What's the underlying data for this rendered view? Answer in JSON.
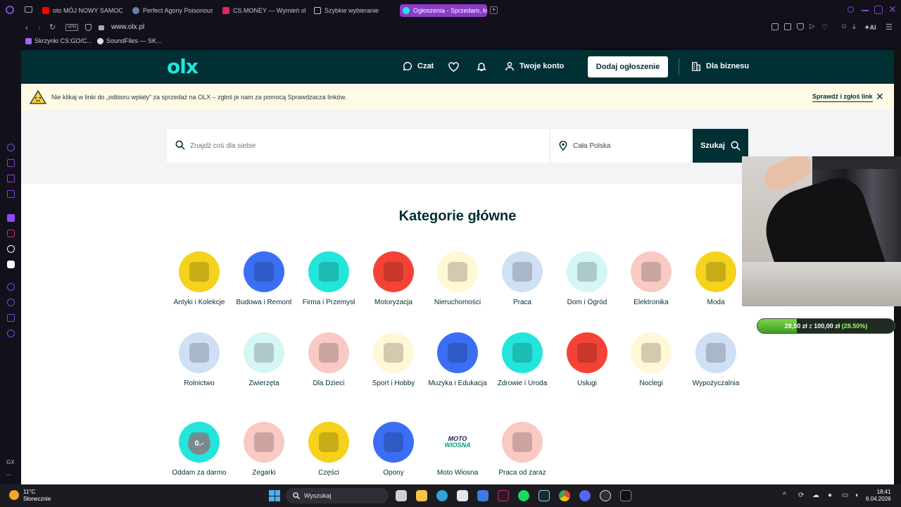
{
  "browser": {
    "tabs": [
      {
        "label": "oto MÓJ NOWY SAMOCHÓ",
        "active": false
      },
      {
        "label": "Perfect Agony Poisonous",
        "active": false
      },
      {
        "label": "CS.MONEY — Wymień skó",
        "active": false
      },
      {
        "label": "Szybkie wybieranie",
        "active": false
      },
      {
        "label": "Ogłoszenia - Sprzedam, ku",
        "active": true
      }
    ],
    "address": "www.olx.pl",
    "vpn_label": "VPN",
    "bookmarks": [
      {
        "label": "Skrzynki CS:GO/C..."
      },
      {
        "label": "SoundFiles — SK..."
      }
    ],
    "ai_label": "AI",
    "gx_label": "GX",
    "more_label": "..."
  },
  "olx": {
    "logo": "olx",
    "chat_label": "Czat",
    "account_label": "Twoje konto",
    "add_listing_label": "Dodaj ogłoszenie",
    "business_label": "Dla biznesu",
    "warning_text": "Nie klikaj w linki do „odbioru wpłaty” za sprzedaż na OLX – zgłoś je nam za pomocą Sprawdzacza linków.",
    "warning_link": "Sprawdź i zgłoś link",
    "search_placeholder": "Znajdź coś dla siebie",
    "location": "Cała Polska",
    "search_button": "Szukaj",
    "categories_title": "Kategorie główne",
    "categories": [
      {
        "label": "Antyki i Kolekcje",
        "color": "#f5d21b",
        "icon": "pocket-watch-icon"
      },
      {
        "label": "Budowa i Remont",
        "color": "#3a6ff5",
        "icon": "bricks-icon"
      },
      {
        "label": "Firma i Przemysł",
        "color": "#23e5db",
        "icon": "headphones-icon"
      },
      {
        "label": "Motoryzacja",
        "color": "#f44336",
        "icon": "car-icon"
      },
      {
        "label": "Nieruchomości",
        "color": "#fff7d6",
        "icon": "keys-icon"
      },
      {
        "label": "Praca",
        "color": "#cfe0f5",
        "icon": "briefcase-icon"
      },
      {
        "label": "Dom i Ogród",
        "color": "#d4f6f4",
        "icon": "armchair-icon"
      },
      {
        "label": "Elektronika",
        "color": "#f9c9c4",
        "icon": "phone-icon"
      },
      {
        "label": "Moda",
        "color": "#f5d21b",
        "icon": "dress-icon"
      },
      {
        "label": "Rolnictwo",
        "color": "#cfe0f5",
        "icon": "tractor-icon"
      },
      {
        "label": "Zwierzęta",
        "color": "#d4f6f4",
        "icon": "dog-icon"
      },
      {
        "label": "Dla Dzieci",
        "color": "#f9c9c4",
        "icon": "stroller-icon"
      },
      {
        "label": "Sport i Hobby",
        "color": "#fff7d6",
        "icon": "football-icon"
      },
      {
        "label": "Muzyka i Edukacja",
        "color": "#3a6ff5",
        "icon": "books-icon"
      },
      {
        "label": "Zdrowie i Uroda",
        "color": "#23e5db",
        "icon": "perfume-icon"
      },
      {
        "label": "Usługi",
        "color": "#f44336",
        "icon": "paint-roller-icon"
      },
      {
        "label": "Noclegi",
        "color": "#fff7d6",
        "icon": "bed-icon"
      },
      {
        "label": "Wypożyczalnia",
        "color": "#cfe0f5",
        "icon": "calendar-icon"
      },
      {
        "label": "Oddam za darmo",
        "color": "#23e5db",
        "icon": "price-tag-icon",
        "badge": "0.-"
      },
      {
        "label": "Zegarki",
        "color": "#f9c9c4",
        "icon": "wristwatch-icon"
      },
      {
        "label": "Części",
        "color": "#f5d21b",
        "icon": "turbo-icon"
      },
      {
        "label": "Opony",
        "color": "#3a6ff5",
        "icon": "tire-icon"
      },
      {
        "label": "Moto Wiosna",
        "color": "#ffffff",
        "icon": "moto-wiosna-logo",
        "logo_a": "MOTO",
        "logo_b": "WIOSNA"
      },
      {
        "label": "Praca od zaraz",
        "color": "#f9c9c4",
        "icon": "workers-icon"
      }
    ]
  },
  "overlay": {
    "caption": "na coś mi wiem jeszcze na co",
    "donation_current": "28,50 zł",
    "donation_of": "z",
    "donation_goal": "100,00 zł",
    "donation_percent_label": "(28.50%)",
    "donation_progress": 0.285
  },
  "taskbar": {
    "temperature": "11°C",
    "weather": "Słonecznie",
    "search_label": "Wyszukaj",
    "time": "18:41",
    "date": "6.04.2026"
  },
  "colors": {
    "olx_dark": "#002f34",
    "olx_teal": "#23e5db",
    "warning_bg": "#fffae6",
    "opera_accent": "#8a3cc8"
  }
}
